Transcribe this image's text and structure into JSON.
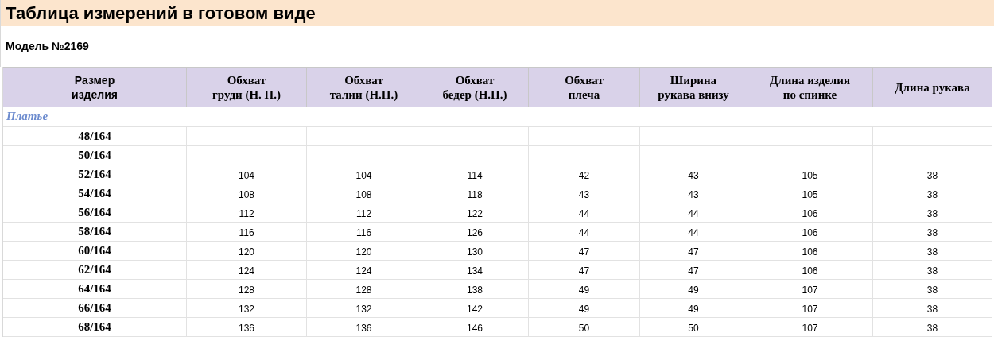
{
  "title": "Таблица измерений в готовом виде",
  "model": "Модель №2169",
  "table": {
    "columns": [
      "Размер\nизделия",
      "Обхват\nгруди (Н. П.)",
      "Обхват\nталии (Н.П.)",
      "Обхват\nбедер (Н.П.)",
      "Обхват\nплеча",
      "Ширина\nрукава внизу",
      "Длина изделия\nпо спинке",
      "Длина рукава"
    ],
    "section": "Платье",
    "rows": [
      {
        "size": "48/164"
      },
      {
        "size": "50/164"
      },
      {
        "size": "52/164",
        "values": [
          "104",
          "104",
          "114",
          "42",
          "43",
          "105",
          "38"
        ]
      },
      {
        "size": "54/164",
        "values": [
          "108",
          "108",
          "118",
          "43",
          "43",
          "105",
          "38"
        ]
      },
      {
        "size": "56/164",
        "values": [
          "112",
          "112",
          "122",
          "44",
          "44",
          "106",
          "38"
        ]
      },
      {
        "size": "58/164",
        "values": [
          "116",
          "116",
          "126",
          "44",
          "44",
          "106",
          "38"
        ]
      },
      {
        "size": "60/164",
        "values": [
          "120",
          "120",
          "130",
          "47",
          "47",
          "106",
          "38"
        ]
      },
      {
        "size": "62/164",
        "values": [
          "124",
          "124",
          "134",
          "47",
          "47",
          "106",
          "38"
        ]
      },
      {
        "size": "64/164",
        "values": [
          "128",
          "128",
          "138",
          "49",
          "49",
          "107",
          "38"
        ]
      },
      {
        "size": "66/164",
        "values": [
          "132",
          "132",
          "142",
          "49",
          "49",
          "107",
          "38"
        ]
      },
      {
        "size": "68/164",
        "values": [
          "136",
          "136",
          "146",
          "50",
          "50",
          "107",
          "38"
        ]
      }
    ]
  }
}
